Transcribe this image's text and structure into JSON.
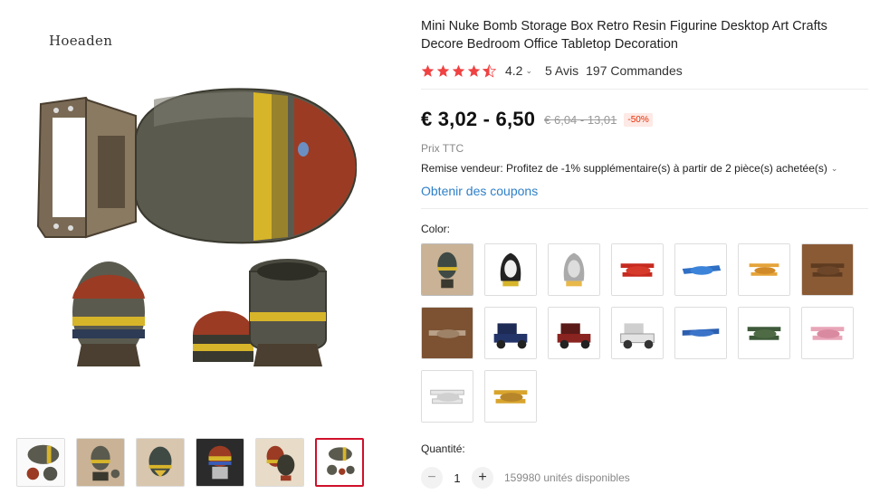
{
  "brand": "Hoeaden",
  "product": {
    "title": "Mini Nuke Bomb Storage Box Retro Resin Figurine Desktop Art Crafts Decore Bedroom Office Tabletop Decoration",
    "rating": "4.2",
    "stars_filled": 4.5,
    "reviews": "5 Avis",
    "orders": "197 Commandes",
    "price": "€ 3,02 - 6,50",
    "old_price": "€ 6,04 - 13,01",
    "discount": "-50%",
    "tax_note": "Prix TTC",
    "seller_discount": "Remise vendeur: Profitez de -1% supplémentaire(s) à partir de 2 pièce(s) achetée(s)",
    "coupons_link": "Obtenir des coupons",
    "color_label": "Color:",
    "quantity_label": "Quantité:",
    "quantity": "1",
    "stock": "159980 unités disponibles"
  },
  "colors": {
    "accent_red": "#d0112b",
    "star_red": "#f04242",
    "link_blue": "#2f80c8"
  },
  "thumbnails": [
    {
      "name": "thumb-1",
      "active": false
    },
    {
      "name": "thumb-2",
      "active": false
    },
    {
      "name": "thumb-3",
      "active": false
    },
    {
      "name": "thumb-4",
      "active": false
    },
    {
      "name": "thumb-5",
      "active": false
    },
    {
      "name": "thumb-6",
      "active": true
    }
  ],
  "swatch_icons": [
    "bomb-photo",
    "egg-rocket-black",
    "egg-rocket-gray",
    "red-biplane",
    "blue-plane",
    "yellow-biplane",
    "brown-biplane-photo",
    "brown-plane-photo",
    "blue-vintage-car",
    "red-vintage-car",
    "white-vintage-car",
    "blue-monoplane",
    "green-biplane",
    "pink-biplane",
    "white-biplane",
    "gold-biplane"
  ]
}
